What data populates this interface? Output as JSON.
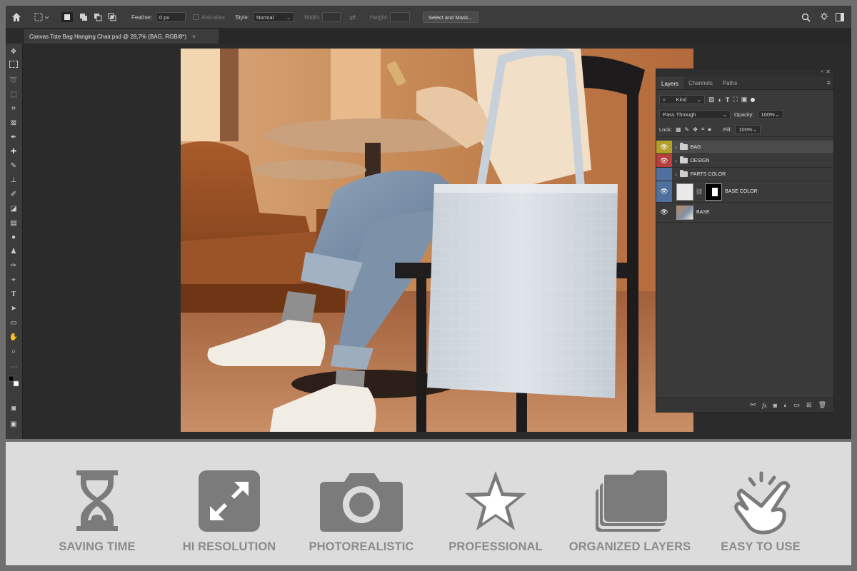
{
  "window": {
    "doc_tab_title": "Canvas Tote Bag Hanging Chair.psd @ 28,7% (BAG, RGB/8*)",
    "close_symbol": "×"
  },
  "options_bar": {
    "feather_label": "Feather:",
    "feather_value": "0 px",
    "antialias_label": "Anti-alias",
    "style_label": "Style:",
    "style_value": "Normal",
    "width_label": "Width:",
    "height_label": "Height:",
    "select_mask_label": "Select and Mask..."
  },
  "layers_panel": {
    "tabs": [
      "Layers",
      "Channels",
      "Paths"
    ],
    "kind_label": "Kind",
    "blend_mode": "Pass Through",
    "opacity_label": "Opacity:",
    "opacity_value": "100%",
    "lock_label": "Lock:",
    "fill_label": "Fill:",
    "fill_value": "100%",
    "layers": [
      {
        "name": "BAG",
        "color": "#b3a02a",
        "visible": true,
        "type": "group",
        "selected": true
      },
      {
        "name": "DESIGN",
        "color": "#b7403f",
        "visible": true,
        "type": "group",
        "selected": false
      },
      {
        "name": "PARTS COLOR",
        "color": "#4f6f9f",
        "visible": false,
        "type": "group",
        "selected": false
      },
      {
        "name": "BASE COLOR",
        "color": "#4f6f9f",
        "visible": true,
        "type": "smart",
        "selected": false
      },
      {
        "name": "BASE",
        "color": "none",
        "visible": true,
        "type": "image",
        "selected": false
      }
    ]
  },
  "features": [
    {
      "label": "SAVING TIME",
      "icon": "hourglass-icon"
    },
    {
      "label": "HI RESOLUTION",
      "icon": "expand-arrows-icon"
    },
    {
      "label": "PHOTOREALISTIC",
      "icon": "camera-icon"
    },
    {
      "label": "PROFESSIONAL",
      "icon": "star-icon"
    },
    {
      "label": "ORGANIZED LAYERS",
      "icon": "stacked-layers-icon"
    },
    {
      "label": "EASY TO USE",
      "icon": "tap-hand-icon"
    }
  ],
  "colors": {
    "feature_icon": "#7b7b7b",
    "feature_label": "#8b8b8b",
    "feature_background": "#dcdcdc",
    "panel_background": "#3a3a3a"
  }
}
